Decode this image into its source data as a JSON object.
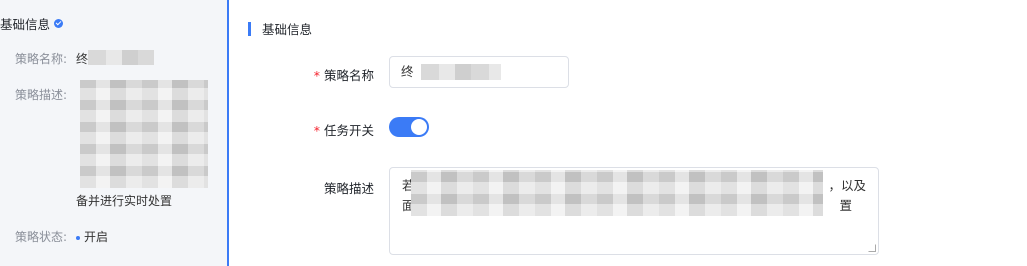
{
  "left_panel": {
    "title": "基础信息",
    "name_label": "策略名称:",
    "name_value_prefix": "终",
    "desc_label": "策略描述:",
    "desc_tail": "备并进行实时处置",
    "status_label": "策略状态:",
    "status_value": "开启"
  },
  "main": {
    "section_title": "基础信息",
    "name_label": "策略名称",
    "name_value_prefix": "终",
    "switch_label": "任务开关",
    "switch_on": true,
    "desc_label": "策略描述",
    "desc_line1_prefix": "若",
    "desc_line1_suffix": "，以及",
    "desc_line2_prefix": "面",
    "desc_line2_suffix": "置",
    "required_mark": "*"
  },
  "colors": {
    "accent": "#3b7bf6",
    "required": "#f5222d"
  }
}
